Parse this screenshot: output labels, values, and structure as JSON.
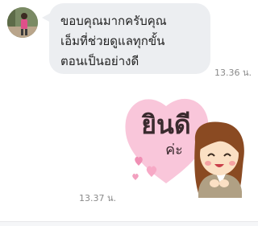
{
  "messages": [
    {
      "sender": "other",
      "lines": [
        "ขอบคุณมากครับคุณ",
        "เอ็มที่ช่วยดูแลทุกขั้น",
        "ตอนเป็นอย่างดี"
      ],
      "time": "13.36 น."
    },
    {
      "sender": "other",
      "sticker": {
        "main_text": "ยินดี",
        "sub_text": "ค่ะ"
      },
      "time": "13.37 น."
    }
  ],
  "colors": {
    "bubble": "#eceef1",
    "heart": "#f9c6da",
    "heart_text": "#3a2a2e",
    "time_text": "#8a8a8a"
  }
}
